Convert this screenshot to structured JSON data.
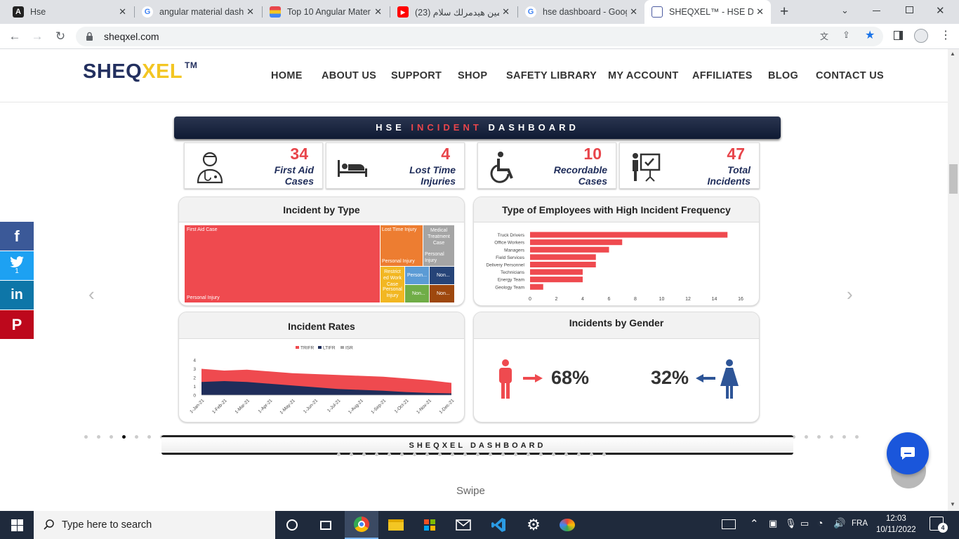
{
  "browser": {
    "tabs": [
      {
        "title": "Hse",
        "favicon": "angular-icon"
      },
      {
        "title": "angular material dashb",
        "favicon": "google-icon"
      },
      {
        "title": "Top 10 Angular Mater",
        "favicon": "site-icon"
      },
      {
        "title": "(23) امين هيدمرلك سلام",
        "favicon": "youtube-icon"
      },
      {
        "title": "hse dashboard - Goog",
        "favicon": "google-icon"
      },
      {
        "title": "SHEQXEL™ - HSE Das",
        "favicon": "page-icon"
      }
    ],
    "url": "sheqxel.com"
  },
  "site": {
    "logo_a": "SHEQ",
    "logo_b": "XEL",
    "logo_tm": "TM",
    "nav": [
      "HOME",
      "ABOUT US",
      "SUPPORT",
      "SHOP",
      "SAFETY LIBRARY",
      "MY ACCOUNT",
      "AFFILIATES",
      "BLOG",
      "CONTACT US"
    ]
  },
  "social": {
    "facebook": "f",
    "twitter_count": "1",
    "linkedin": "in",
    "pinterest": "P"
  },
  "dashboard": {
    "title_a": "HSE",
    "title_b": "INCIDENT",
    "title_c": "DASHBOARD",
    "kpis": [
      {
        "value": "34",
        "label1": "First Aid",
        "label2": "Cases",
        "icon": "doctor-icon"
      },
      {
        "value": "4",
        "label1": "Lost Time",
        "label2": "Injuries",
        "icon": "hospital-bed-icon"
      },
      {
        "value": "10",
        "label1": "Recordable",
        "label2": "Cases",
        "icon": "wheelchair-icon"
      },
      {
        "value": "47",
        "label1": "Total",
        "label2": "Incidents",
        "icon": "presentation-icon"
      }
    ],
    "incident_by_type": {
      "title": "Incident by Type",
      "cells": [
        {
          "t1": "First Aid Case",
          "t2": "Personal Injury",
          "color": "#ef4a4f"
        },
        {
          "t1": "Lost Time Injury",
          "t2": "Personal Injury",
          "color": "#ed7d31"
        },
        {
          "t1": "Medical Treatment Case",
          "t2": "Personal Injury",
          "color": "#a5a5a5"
        },
        {
          "t1": "Restrict ed Work Case",
          "t2": "Personal Injury",
          "color": "#f2b722"
        },
        {
          "t1": "Person...",
          "t2": "",
          "color": "#5b9bd5"
        },
        {
          "t1": "Non...",
          "t2": "",
          "color": "#264478"
        },
        {
          "t1": "Non...",
          "t2": "",
          "color": "#70ad47"
        },
        {
          "t1": "Non...",
          "t2": "",
          "color": "#9e480e"
        }
      ]
    },
    "employees": {
      "title": "Type of Employees with High Incident Frequency"
    },
    "rates": {
      "title": "Incident Rates",
      "legend": [
        "TRIFR",
        "LTIFR",
        "ISR"
      ]
    },
    "gender": {
      "title": "Incidents by Gender",
      "male_pct": "68%",
      "female_pct": "32%"
    }
  },
  "carousel": {
    "sub_title": "SHEQXEL DASHBOARD",
    "swipe": "Swipe"
  },
  "taskbar": {
    "search_placeholder": "Type here to search",
    "language": "FRA",
    "time": "12:03",
    "date": "10/11/2022",
    "notifications": "4"
  },
  "chart_data": [
    {
      "type": "bar",
      "orientation": "horizontal",
      "categories": [
        "Truck Drivers",
        "Office Workers",
        "Managers",
        "Field Services",
        "Delivery Personnel",
        "Technicians",
        "Energy Team",
        "Geology Team"
      ],
      "values": [
        15,
        7,
        6,
        5,
        5,
        4,
        4,
        1
      ],
      "xlim": [
        0,
        16
      ],
      "xticks": [
        0,
        2,
        4,
        6,
        8,
        10,
        12,
        14,
        16
      ],
      "color": "#ef4a4f"
    },
    {
      "type": "area",
      "x": [
        "1-Jan-21",
        "1-Feb-21",
        "1-Mar-21",
        "1-Apr-21",
        "1-May-21",
        "1-Jun-21",
        "1-Jul-21",
        "1-Aug-21",
        "1-Sep-21",
        "1-Oct-21",
        "1-Nov-21",
        "1-Dec-21"
      ],
      "series": [
        {
          "name": "TRIFR",
          "values": [
            3.0,
            2.8,
            2.9,
            2.7,
            2.5,
            2.4,
            2.3,
            2.2,
            2.1,
            1.9,
            1.7,
            1.4
          ],
          "color": "#ef4a4f"
        },
        {
          "name": "LTIFR",
          "values": [
            1.5,
            1.6,
            1.5,
            1.3,
            1.1,
            0.9,
            0.7,
            0.6,
            0.5,
            0.35,
            0.25,
            0.2
          ],
          "color": "#1f2d5a"
        },
        {
          "name": "ISR",
          "values": [
            0,
            0,
            0,
            0,
            0,
            0,
            0,
            0,
            0,
            0,
            0,
            0
          ],
          "color": "#a5a5a5"
        }
      ],
      "ylim": [
        0,
        4
      ],
      "yticks": [
        0,
        1,
        2,
        3,
        4
      ]
    }
  ]
}
